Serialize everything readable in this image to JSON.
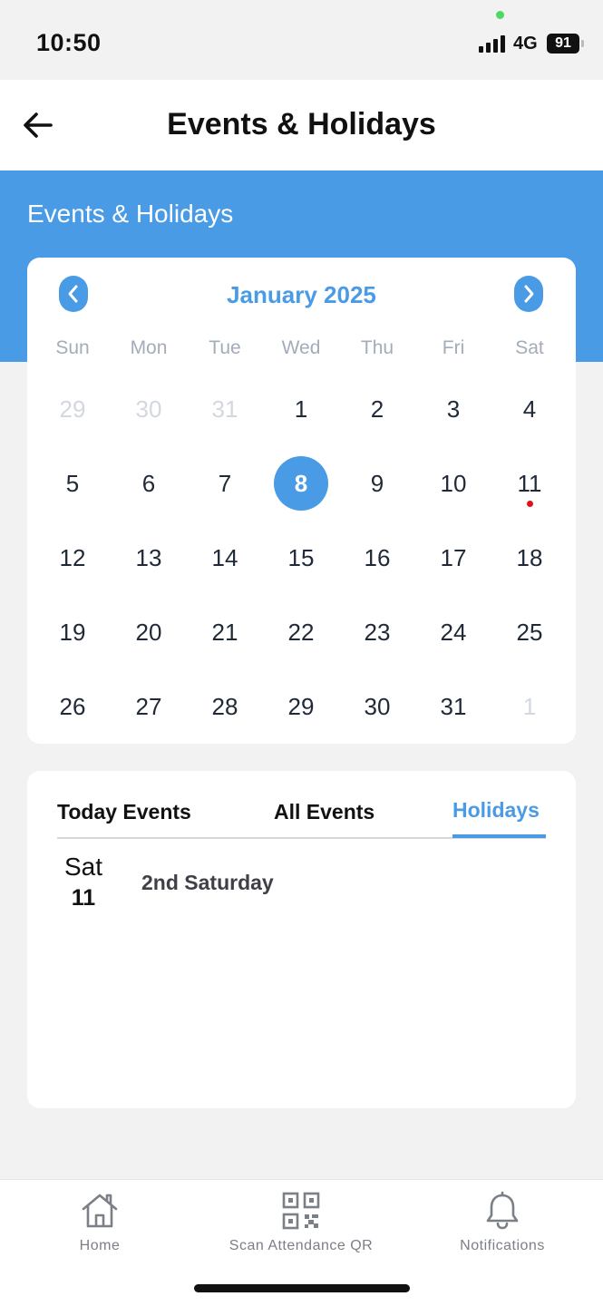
{
  "status_bar": {
    "time": "10:50",
    "network": "4G",
    "battery": "91"
  },
  "header": {
    "title": "Events & Holidays"
  },
  "banner": {
    "title": "Events & Holidays"
  },
  "calendar": {
    "month_label": "January 2025",
    "weekdays": [
      "Sun",
      "Mon",
      "Tue",
      "Wed",
      "Thu",
      "Fri",
      "Sat"
    ],
    "selected_day": "8",
    "days": [
      {
        "label": "29",
        "muted": true
      },
      {
        "label": "30",
        "muted": true
      },
      {
        "label": "31",
        "muted": true
      },
      {
        "label": "1"
      },
      {
        "label": "2"
      },
      {
        "label": "3"
      },
      {
        "label": "4"
      },
      {
        "label": "5"
      },
      {
        "label": "6"
      },
      {
        "label": "7"
      },
      {
        "label": "8",
        "selected": true
      },
      {
        "label": "9"
      },
      {
        "label": "10"
      },
      {
        "label": "11",
        "holiday_marker": true
      },
      {
        "label": "12"
      },
      {
        "label": "13"
      },
      {
        "label": "14"
      },
      {
        "label": "15"
      },
      {
        "label": "16"
      },
      {
        "label": "17"
      },
      {
        "label": "18"
      },
      {
        "label": "19"
      },
      {
        "label": "20"
      },
      {
        "label": "21"
      },
      {
        "label": "22"
      },
      {
        "label": "23"
      },
      {
        "label": "24"
      },
      {
        "label": "25"
      },
      {
        "label": "26"
      },
      {
        "label": "27"
      },
      {
        "label": "28"
      },
      {
        "label": "29"
      },
      {
        "label": "30"
      },
      {
        "label": "31"
      },
      {
        "label": "1",
        "muted": true
      }
    ],
    "colors": {
      "accent": "#4a9be6",
      "holiday_dot": "#e0111b"
    }
  },
  "events": {
    "tabs": [
      {
        "label": "Today Events",
        "active": false
      },
      {
        "label": "All Events",
        "active": false
      },
      {
        "label": "Holidays",
        "active": true
      }
    ],
    "holidays": [
      {
        "weekday": "Sat",
        "day": "11",
        "name": "2nd Saturday"
      }
    ]
  },
  "bottom_nav": {
    "items": [
      {
        "label": "Home",
        "icon": "home-icon"
      },
      {
        "label": "Scan Attendance QR",
        "icon": "qr-code-icon"
      },
      {
        "label": "Notifications",
        "icon": "bell-icon"
      }
    ]
  }
}
